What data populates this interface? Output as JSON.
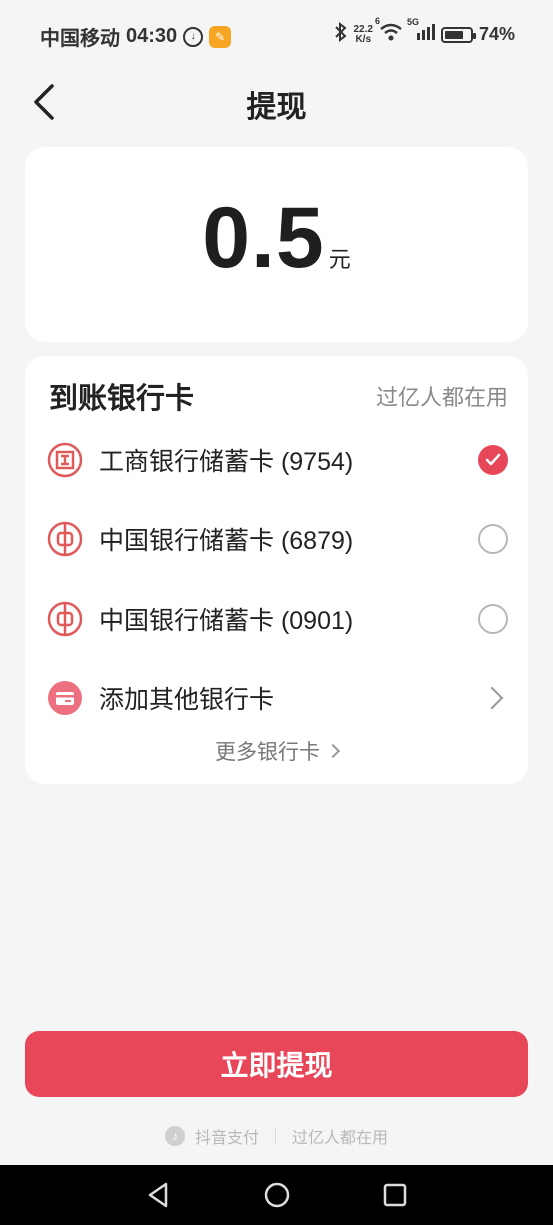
{
  "status_bar": {
    "carrier": "中国移动",
    "time": "04:30",
    "net_speed_value": "22.2",
    "net_speed_unit": "K/s",
    "wifi_badge": "6",
    "signal_badge": "5G",
    "battery_percent": "74%",
    "battery_level": 0.74
  },
  "header": {
    "title": "提现"
  },
  "amount": {
    "value": "0.5",
    "unit": "元"
  },
  "bank_section": {
    "title": "到账银行卡",
    "tagline": "过亿人都在用",
    "banks": [
      {
        "name": "工商银行储蓄卡 (9754)",
        "icon": "icbc-logo-icon",
        "selected": true
      },
      {
        "name": "中国银行储蓄卡 (6879)",
        "icon": "boc-logo-icon",
        "selected": false
      },
      {
        "name": "中国银行储蓄卡 (0901)",
        "icon": "boc-logo-icon",
        "selected": false
      }
    ],
    "add_card_label": "添加其他银行卡",
    "more_cards_label": "更多银行卡"
  },
  "action": {
    "withdraw_label": "立即提现"
  },
  "footer": {
    "brand": "抖音支付",
    "tagline": "过亿人都在用"
  },
  "colors": {
    "accent": "#e8475a",
    "background": "#f5f5f5",
    "card": "#ffffff",
    "bank_logo": "#e05a5a"
  }
}
